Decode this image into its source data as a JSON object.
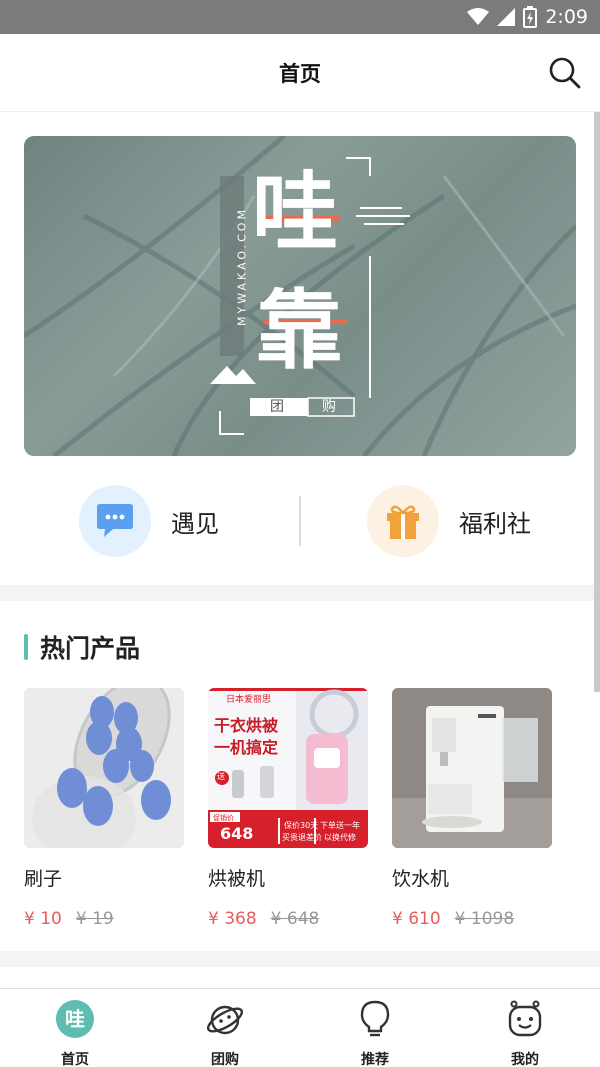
{
  "status_bar": {
    "time": "2:09"
  },
  "header": {
    "title": "首页"
  },
  "banner": {
    "vertical_text": "MYWAKAO.COM",
    "char1": "哇",
    "char2": "靠",
    "tag1": "团",
    "tag2": "购"
  },
  "quick_links": [
    {
      "label": "遇见",
      "icon": "chat-bubble-icon"
    },
    {
      "label": "福利社",
      "icon": "gift-icon"
    }
  ],
  "hot_products": {
    "title": "热门产品",
    "items": [
      {
        "name": "刷子",
        "price": "¥ 10",
        "old_price": "¥ 19"
      },
      {
        "name": "烘被机",
        "price": "¥ 368",
        "old_price": "¥ 648",
        "img_text": {
          "brand": "日本爱丽思",
          "line1": "干衣烘被",
          "line2": "一机搞定",
          "gift": "送",
          "promo_label": "促销价",
          "promo_price": "648",
          "tag1": "保价30天",
          "tag1b": "买贵退差价",
          "tag2": "下单送一年",
          "tag2b": "以换代修"
        }
      },
      {
        "name": "饮水机",
        "price": "¥ 610",
        "old_price": "¥ 1098"
      }
    ]
  },
  "tabs": [
    {
      "label": "首页",
      "icon": "home-logo-icon",
      "active": true
    },
    {
      "label": "团购",
      "icon": "planet-icon",
      "active": false
    },
    {
      "label": "推荐",
      "icon": "lightbulb-icon",
      "active": false
    },
    {
      "label": "我的",
      "icon": "smiley-icon",
      "active": false
    }
  ],
  "colors": {
    "accent": "#5fbcb1",
    "price": "#e65c5c",
    "chat_icon_bg": "#e3f0fd",
    "gift_icon_bg": "#fdf1e3"
  }
}
